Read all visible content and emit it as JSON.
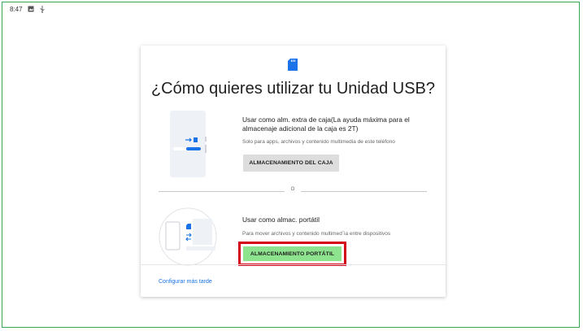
{
  "status_bar": {
    "time": "8:47",
    "icons": [
      "image-icon",
      "usb-icon"
    ]
  },
  "dialog": {
    "title": "¿Cómo quieres utilizar tu Unidad USB?",
    "header_icon": "sd-card-icon",
    "option_internal": {
      "title": "Usar como alm. extra de caja(La ayuda máxima para el almacenaje adicional de la caja es 2T)",
      "subtitle": "Solo para apps, archivos y contenido multimedia de este teléfono",
      "button_label": "ALMACENAMIENTO DEL CAJA"
    },
    "divider_label": "O",
    "option_portable": {
      "title": "Usar como almac. portátil",
      "subtitle": "Para mover archivos y contenido multimed¨ia entre dispositivos",
      "button_label": "ALMACENAMIENTO PORTÁTIL"
    },
    "later_link": "Configurar más tarde"
  },
  "colors": {
    "accent": "#1a73e8",
    "highlight_border": "#d4001a",
    "portable_button": "#8ee38e",
    "frame": "#34a853"
  }
}
